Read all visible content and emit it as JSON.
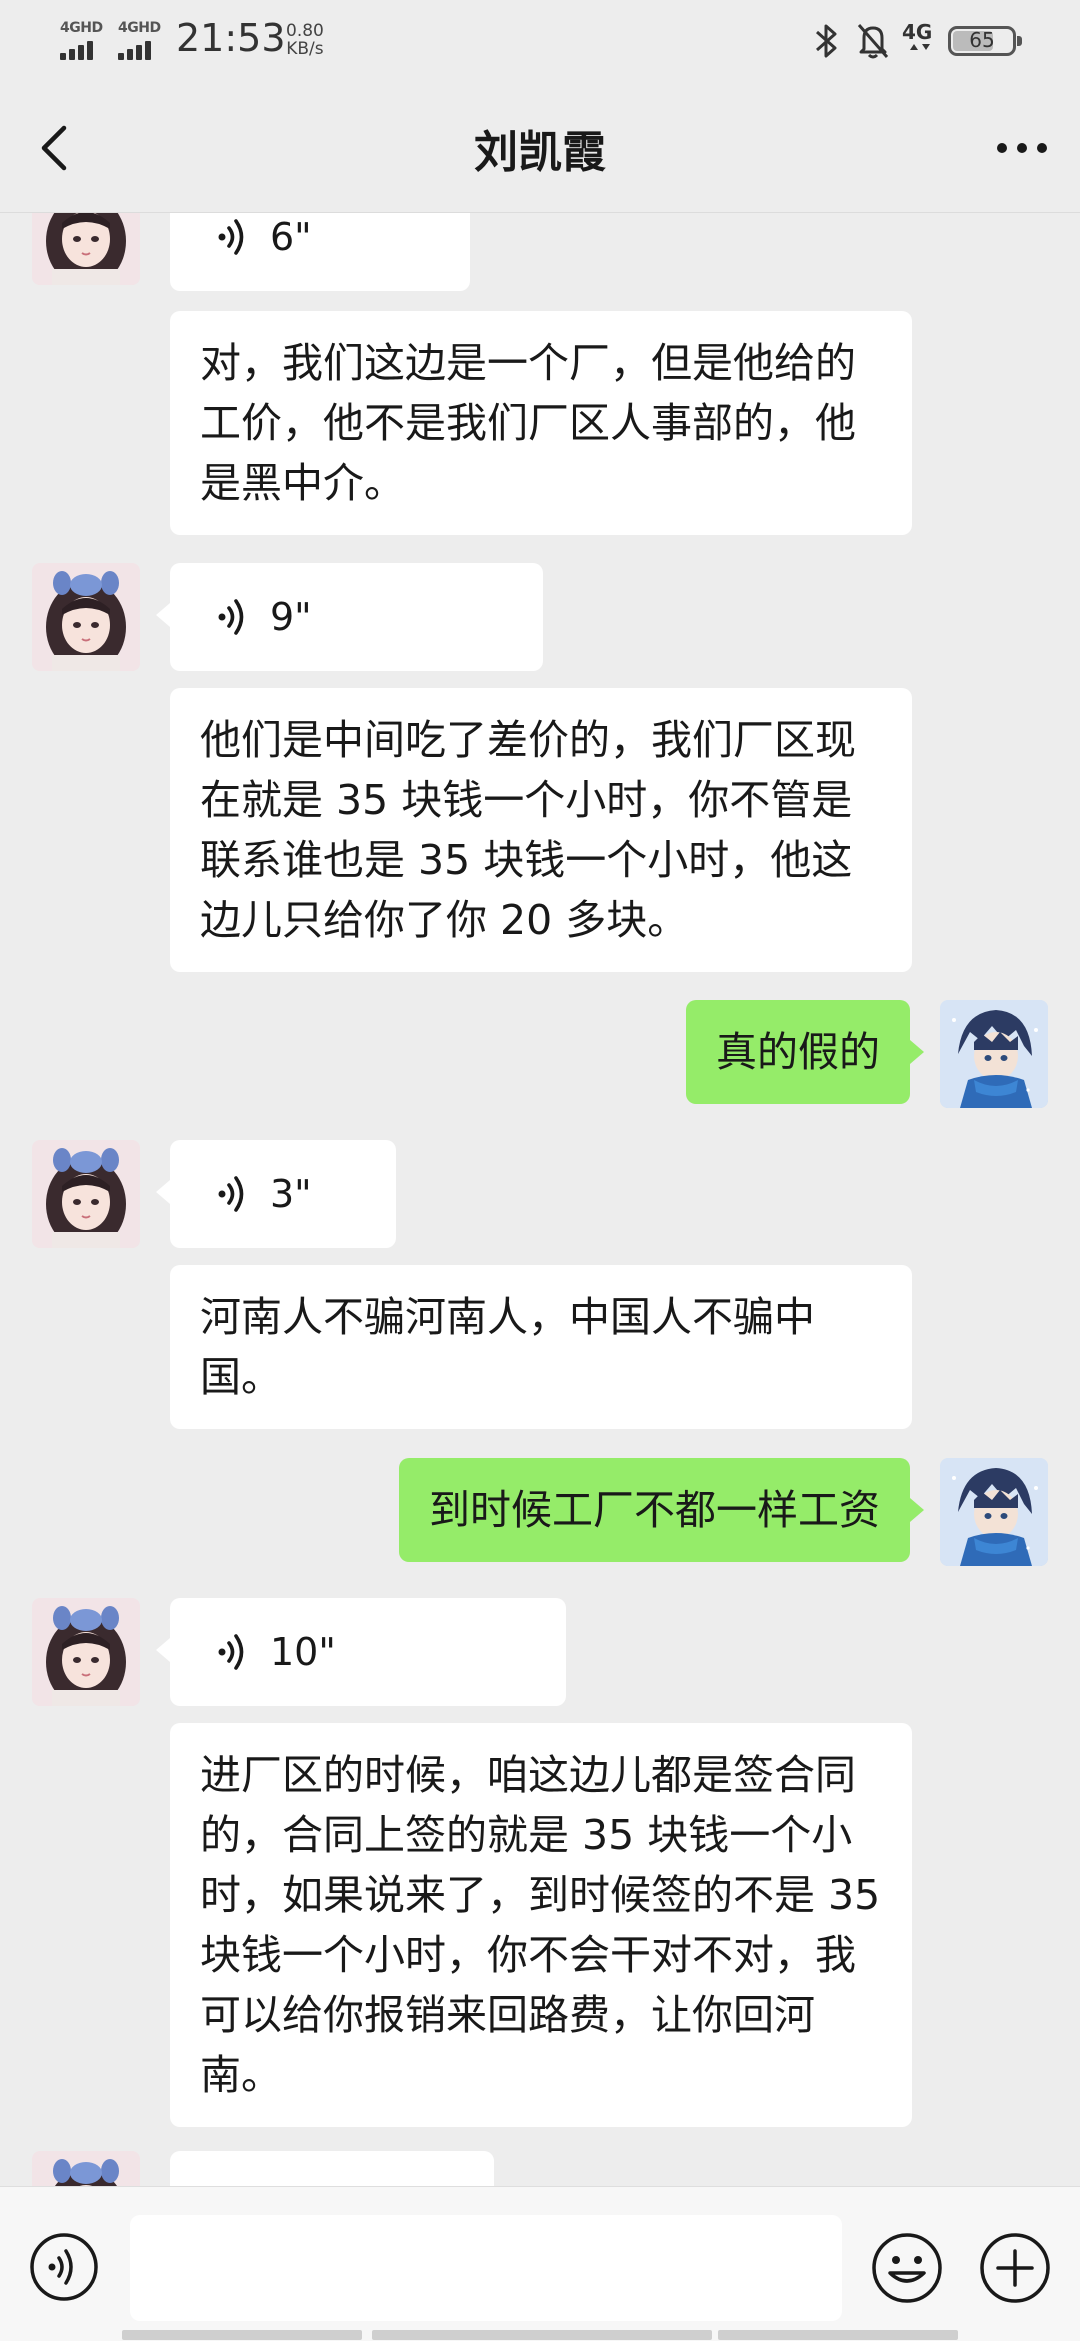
{
  "status_bar": {
    "network_1": "4GHD",
    "network_2": "4GHD",
    "time": "21:53",
    "speed_value": "0.80",
    "speed_unit": "KB/s",
    "network_3": "4G",
    "battery": "65"
  },
  "header": {
    "title": "刘凯霞",
    "back_icon": "chevron-left-icon",
    "more_icon": "more-dots-icon"
  },
  "messages": [
    {
      "from": "other",
      "type": "voice",
      "duration": "6\""
    },
    {
      "from": "other",
      "type": "text",
      "text": "对，我们这边是一个厂，但是他给的工价，他不是我们厂区人事部的，他是黑中介。"
    },
    {
      "from": "other",
      "type": "voice",
      "duration": "9\""
    },
    {
      "from": "other",
      "type": "text",
      "text": "他们是中间吃了差价的，我们厂区现在就是 35 块钱一个小时，你不管是联系谁也是 35 块钱一个小时，他这边儿只给你了你 20 多块。"
    },
    {
      "from": "me",
      "type": "text",
      "text": "真的假的"
    },
    {
      "from": "other",
      "type": "voice",
      "duration": "3\""
    },
    {
      "from": "other",
      "type": "text",
      "text": "河南人不骗河南人，中国人不骗中国。"
    },
    {
      "from": "me",
      "type": "text",
      "text": "到时候工厂不都一样工资"
    },
    {
      "from": "other",
      "type": "voice",
      "duration": "10\""
    },
    {
      "from": "other",
      "type": "text",
      "text": "进厂区的时候，咱这边儿都是签合同的，合同上签的就是 35 块钱一个小时，如果说来了，到时候签的不是 35 块钱一个小时，你不会干对不对，我可以给你报销来回路费，让你回河南。"
    }
  ],
  "input_bar": {
    "voice_icon": "voice-input-icon",
    "placeholder": "",
    "emoji_icon": "emoji-icon",
    "plus_icon": "plus-icon"
  },
  "colors": {
    "background": "#ededed",
    "my_bubble": "#95ec69",
    "their_bubble": "#ffffff"
  }
}
